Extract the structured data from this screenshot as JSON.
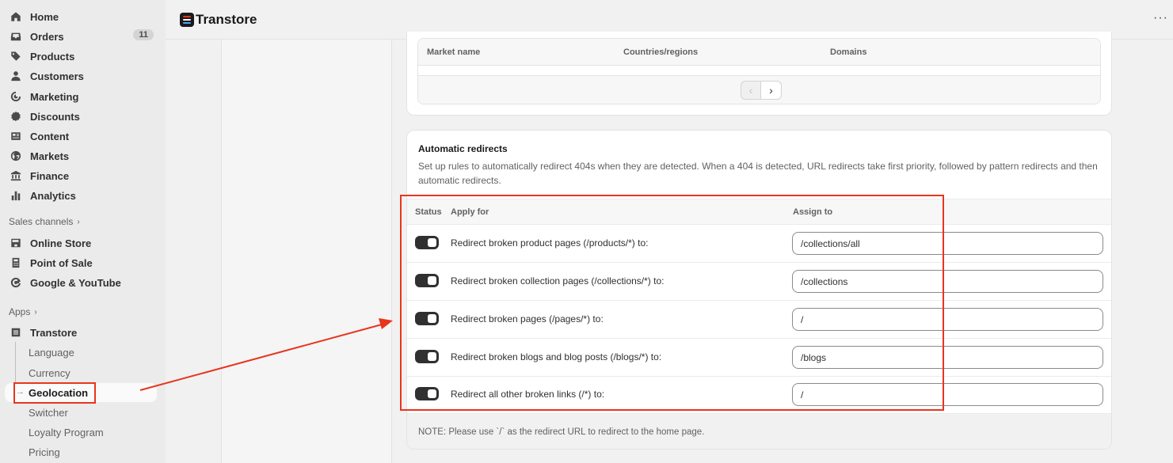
{
  "sidebar": {
    "nav": [
      {
        "label": "Home",
        "icon": "home-icon"
      },
      {
        "label": "Orders",
        "icon": "inbox-icon",
        "badge": "11"
      },
      {
        "label": "Products",
        "icon": "tag-icon"
      },
      {
        "label": "Customers",
        "icon": "person-icon"
      },
      {
        "label": "Marketing",
        "icon": "target-icon"
      },
      {
        "label": "Discounts",
        "icon": "discount-icon"
      },
      {
        "label": "Content",
        "icon": "content-icon"
      },
      {
        "label": "Markets",
        "icon": "globe-icon"
      },
      {
        "label": "Finance",
        "icon": "bank-icon"
      },
      {
        "label": "Analytics",
        "icon": "bar-chart-icon"
      }
    ],
    "sales_channels_label": "Sales channels",
    "channels": [
      {
        "label": "Online Store",
        "icon": "store-icon"
      },
      {
        "label": "Point of Sale",
        "icon": "pos-icon"
      },
      {
        "label": "Google & YouTube",
        "icon": "google-icon"
      }
    ],
    "apps_label": "Apps",
    "app": {
      "label": "Transtore",
      "icon": "transtore-icon"
    },
    "app_sub": [
      "Language",
      "Currency",
      "Geolocation",
      "Switcher",
      "Loyalty Program",
      "Pricing"
    ],
    "active_sub": "Geolocation"
  },
  "header": {
    "app_title": "Transtore",
    "more_label": "···"
  },
  "markets_table": {
    "columns": [
      "Market name",
      "Countries/regions",
      "Domains"
    ],
    "prev_label": "‹",
    "next_label": "›"
  },
  "redirects": {
    "title": "Automatic redirects",
    "description": "Set up rules to automatically redirect 404s when they are detected. When a 404 is detected, URL redirects take first priority, followed by pattern redirects and then automatic redirects.",
    "columns": {
      "status": "Status",
      "apply_for": "Apply for",
      "assign_to": "Assign to"
    },
    "rows": [
      {
        "label": "Redirect broken product pages (/products/*) to:",
        "value": "/collections/all",
        "enabled": true
      },
      {
        "label": "Redirect broken collection pages (/collections/*) to:",
        "value": "/collections",
        "enabled": true
      },
      {
        "label": "Redirect broken pages (/pages/*) to:",
        "value": "/",
        "enabled": true
      },
      {
        "label": "Redirect broken blogs and blog posts (/blogs/*) to:",
        "value": "/blogs",
        "enabled": true
      },
      {
        "label": "Redirect all other broken links (/*) to:",
        "value": "/",
        "enabled": true
      }
    ],
    "note": "NOTE: Please use `/` as the redirect URL to redirect to the home page."
  },
  "colors": {
    "annotation": "#e8351e",
    "toggle_on": "#303030"
  }
}
